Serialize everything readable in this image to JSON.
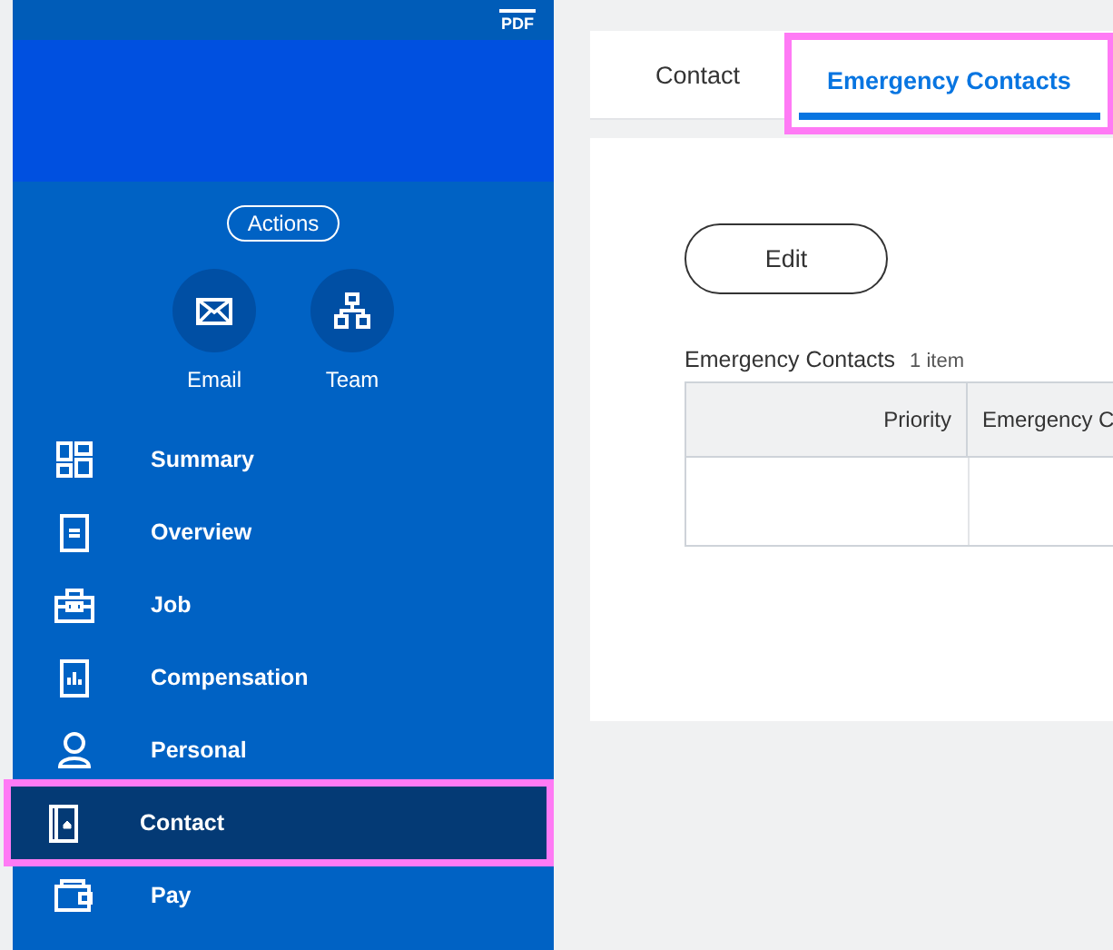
{
  "sidebar": {
    "pdf_label": "PDF",
    "actions_label": "Actions",
    "quick_actions": [
      {
        "kind": "email",
        "label": "Email"
      },
      {
        "kind": "team",
        "label": "Team"
      }
    ],
    "nav_items": [
      {
        "kind": "summary",
        "label": "Summary",
        "selected": false,
        "highlighted": false
      },
      {
        "kind": "overview",
        "label": "Overview",
        "selected": false,
        "highlighted": false
      },
      {
        "kind": "job",
        "label": "Job",
        "selected": false,
        "highlighted": false
      },
      {
        "kind": "compensation",
        "label": "Compensation",
        "selected": false,
        "highlighted": false
      },
      {
        "kind": "personal",
        "label": "Personal",
        "selected": false,
        "highlighted": false
      },
      {
        "kind": "contact",
        "label": "Contact",
        "selected": true,
        "highlighted": true
      },
      {
        "kind": "pay",
        "label": "Pay",
        "selected": false,
        "highlighted": false
      }
    ]
  },
  "tabs": [
    {
      "label": "Contact",
      "selected": false,
      "highlighted": false
    },
    {
      "label": "Emergency Contacts",
      "selected": true,
      "highlighted": true
    }
  ],
  "edit_button": "Edit",
  "table": {
    "title": "Emergency Contacts",
    "count": "1 item",
    "columns": [
      "Priority",
      "Emergency C"
    ]
  }
}
